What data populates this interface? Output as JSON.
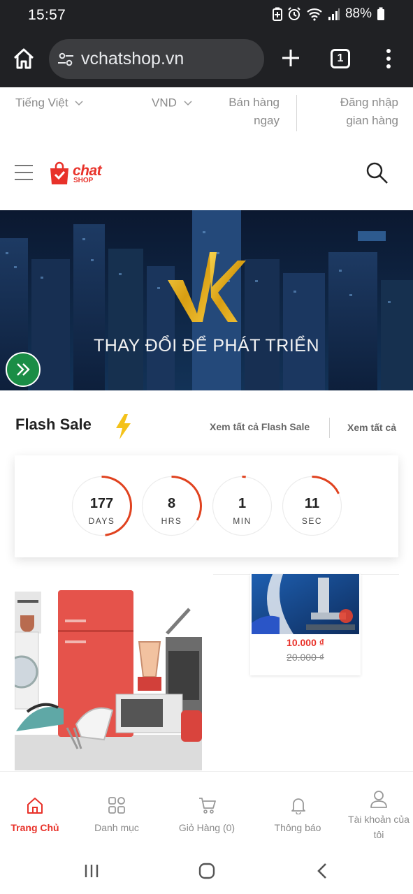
{
  "status_bar": {
    "time": "15:57",
    "battery": "88%"
  },
  "browser": {
    "url": "vchatshop.vn",
    "tab_count": "1"
  },
  "top_options": {
    "language": "Tiếng Việt",
    "currency": "VND",
    "sell_now": "Bán hàng ngay",
    "login": "Đăng nhập gian hàng"
  },
  "header": {
    "logo_text": "chat",
    "logo_sub": "SHOP"
  },
  "banner": {
    "caption": "THAY ĐỔI ĐỂ PHÁT TRIỂN"
  },
  "flash_sale": {
    "title": "Flash Sale",
    "see_all_flash": "Xem tất cả Flash Sale",
    "see_all": "Xem tất cả",
    "countdown": [
      {
        "value": "177",
        "label": "DAYS",
        "progress": 0.48
      },
      {
        "value": "8",
        "label": "HRS",
        "progress": 0.33
      },
      {
        "value": "1",
        "label": "MIN",
        "progress": 0.02
      },
      {
        "value": "11",
        "label": "SEC",
        "progress": 0.18
      }
    ]
  },
  "products": [
    {
      "price": "10.000 ₫",
      "old_price": "20.000 ₫"
    }
  ],
  "bottom_nav": {
    "home": "Trang Chủ",
    "categories": "Danh mục",
    "cart": "Giỏ Hàng (0)",
    "notifications": "Thông báo",
    "account": "Tài khoản của tôi"
  },
  "colors": {
    "brand_red": "#e8322a",
    "fab_green": "#1a8d46",
    "chrome_dark": "#202124"
  },
  "icons": [
    "home-icon",
    "tune-icon",
    "plus-icon",
    "tabs-icon",
    "more-vert-icon",
    "search-icon",
    "hamburger-icon",
    "bolt-icon",
    "cart-icon",
    "bell-icon",
    "user-icon",
    "grid-icon"
  ]
}
